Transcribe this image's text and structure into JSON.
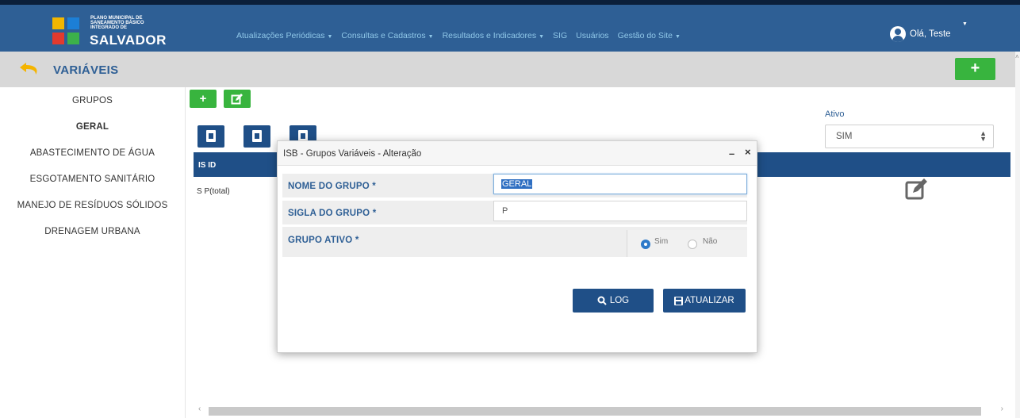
{
  "header": {
    "logo_small": "PLANO MUNICIPAL DE SANEAMENTO BÁSICO INTEGRADO DE",
    "logo_big": "SALVADOR",
    "nav": [
      {
        "label": "Atualizações Periódicas",
        "has_caret": true
      },
      {
        "label": "Consultas e Cadastros",
        "has_caret": true
      },
      {
        "label": "Resultados e Indicadores",
        "has_caret": true
      },
      {
        "label": "SIG",
        "has_caret": false
      },
      {
        "label": "Usuários",
        "has_caret": false
      },
      {
        "label": "Gestão do Site",
        "has_caret": true
      }
    ],
    "user_greeting": "Olá, Teste",
    "colors": {
      "bar": "#2e5f95",
      "nav_text": "#8fc7e8"
    }
  },
  "titlebar": {
    "title": "VARIÁVEIS",
    "add_label": "+",
    "back_icon": "undo-arrow-icon"
  },
  "sidebar": {
    "items": [
      {
        "label": "GRUPOS",
        "active": false
      },
      {
        "label": "GERAL",
        "active": true
      },
      {
        "label": "ABASTECIMENTO DE ÁGUA",
        "active": false
      },
      {
        "label": "ESGOTAMENTO SANITÁRIO",
        "active": false
      },
      {
        "label": "MANEJO DE RESÍDUOS SÓLIDOS",
        "active": false
      },
      {
        "label": "DRENAGEM URBANA",
        "active": false
      }
    ]
  },
  "main": {
    "add_label": "+",
    "edit_icon": "edit-square-icon",
    "export_icons": [
      "excel-file-icon",
      "pdf-file-icon",
      "doc-file-icon"
    ],
    "table": {
      "header": "IS ID",
      "row": "S  P(total)"
    },
    "filter": {
      "label": "Ativo",
      "value": "SIM"
    }
  },
  "modal": {
    "title": "ISB - Grupos Variáveis - Alteração",
    "fields": {
      "nome_label": "NOME DO GRUPO *",
      "nome_value": "GERAL",
      "sigla_label": "SIGLA DO GRUPO *",
      "sigla_value": "P",
      "ativo_label": "GRUPO ATIVO *",
      "radio_sim": "Sim",
      "radio_nao": "Não",
      "selected": "Sim"
    },
    "buttons": {
      "log": "LOG",
      "update": "ATUALIZAR"
    },
    "colors": {
      "button": "#1f4f87",
      "label": "#2e5f95",
      "green": "#38b43e"
    }
  }
}
